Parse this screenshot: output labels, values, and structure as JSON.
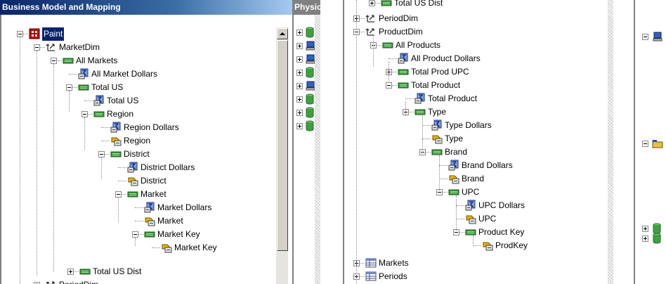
{
  "panels": {
    "business_model_title": "Business Model and Mapping",
    "physical_title": "Physic"
  },
  "left_tree": [
    {
      "label": "Paint",
      "icon": "subject-area-icon",
      "selected": true
    },
    {
      "label": "MarketDim",
      "icon": "dimension-icon"
    },
    {
      "label": "All Markets",
      "icon": "level-icon"
    },
    {
      "label": "All Market Dollars",
      "icon": "measure-icon"
    },
    {
      "label": "Total US",
      "icon": "level-icon"
    },
    {
      "label": "Total US",
      "icon": "measure-icon"
    },
    {
      "label": "Region",
      "icon": "level-icon"
    },
    {
      "label": "Region Dollars",
      "icon": "measure-icon"
    },
    {
      "label": "Region",
      "icon": "key-icon"
    },
    {
      "label": "District",
      "icon": "level-icon"
    },
    {
      "label": "District Dollars",
      "icon": "measure-icon"
    },
    {
      "label": "District",
      "icon": "key-icon"
    },
    {
      "label": "Market",
      "icon": "level-icon"
    },
    {
      "label": "Market Dollars",
      "icon": "measure-icon"
    },
    {
      "label": "Market",
      "icon": "key-icon"
    },
    {
      "label": "Market Key",
      "icon": "level-icon"
    },
    {
      "label": "Market Key",
      "icon": "key-icon"
    },
    {
      "label": "Total US Dist",
      "icon": "level-icon"
    },
    {
      "label": "PeriodDim",
      "icon": "dimension-icon"
    }
  ],
  "middle_tree": [
    {
      "label": "Total US Dist",
      "icon": "level-icon"
    },
    {
      "label": "PeriodDim",
      "icon": "dimension-icon"
    },
    {
      "label": "ProductDim",
      "icon": "dimension-icon"
    },
    {
      "label": "All Products",
      "icon": "level-icon"
    },
    {
      "label": "All Product Dollars",
      "icon": "measure-icon"
    },
    {
      "label": "Total Prod UPC",
      "icon": "level-icon"
    },
    {
      "label": "Total Product",
      "icon": "level-icon"
    },
    {
      "label": "Total Product",
      "icon": "measure-icon"
    },
    {
      "label": "Type",
      "icon": "level-icon"
    },
    {
      "label": "Type Dollars",
      "icon": "measure-icon"
    },
    {
      "label": "Type",
      "icon": "key-icon"
    },
    {
      "label": "Brand",
      "icon": "level-icon"
    },
    {
      "label": "Brand Dollars",
      "icon": "measure-icon"
    },
    {
      "label": "Brand",
      "icon": "key-icon"
    },
    {
      "label": "UPC",
      "icon": "level-icon"
    },
    {
      "label": "UPC Dollars",
      "icon": "measure-icon"
    },
    {
      "label": "UPC",
      "icon": "key-icon"
    },
    {
      "label": "Product Key",
      "icon": "level-icon"
    },
    {
      "label": "ProdKey",
      "icon": "key-icon"
    },
    {
      "label": "Markets",
      "icon": "table-icon"
    },
    {
      "label": "Periods",
      "icon": "table-icon"
    }
  ],
  "colors": {
    "titlebar_gradient_start": "#0a246a",
    "titlebar_gradient_end": "#a6caf0",
    "inactive_titlebar": "#808080",
    "selection": "#0a246a",
    "window_face": "#d4d0c8"
  }
}
